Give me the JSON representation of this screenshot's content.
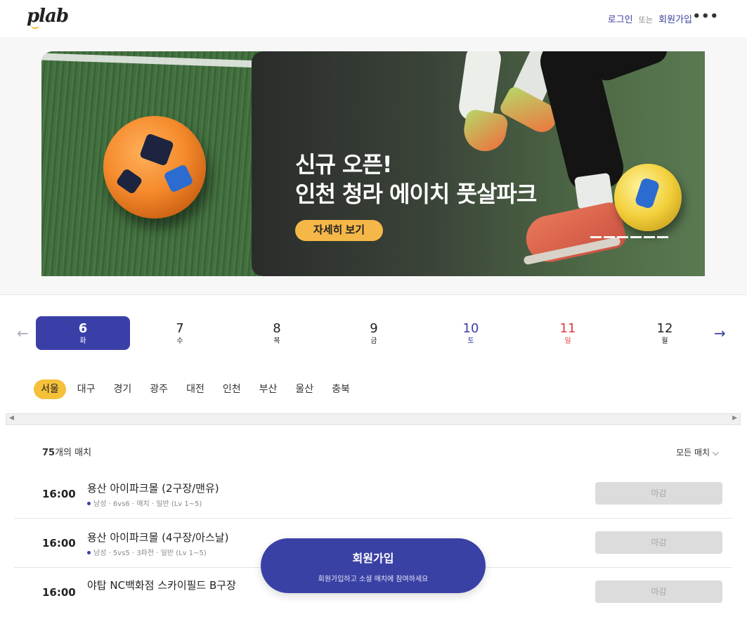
{
  "header": {
    "logo": "plab",
    "login": "로그인",
    "or": "또는",
    "signup": "회원가입",
    "more_icon": "more-dots-icon"
  },
  "banner": {
    "title_line1": "신규 오픈!",
    "title_line2": "인천 청라 에이치 풋살파크",
    "detail_button": "자세히 보기",
    "slide_count": 6
  },
  "dates": {
    "prev_icon": "arrow-left-icon",
    "next_icon": "arrow-right-icon",
    "days": [
      {
        "num": "6",
        "dow": "화"
      },
      {
        "num": "7",
        "dow": "수"
      },
      {
        "num": "8",
        "dow": "목"
      },
      {
        "num": "9",
        "dow": "금"
      },
      {
        "num": "10",
        "dow": "토"
      },
      {
        "num": "11",
        "dow": "일"
      },
      {
        "num": "12",
        "dow": "월"
      }
    ]
  },
  "regions": [
    "서울",
    "대구",
    "경기",
    "광주",
    "대전",
    "인천",
    "부산",
    "울산",
    "충북"
  ],
  "matches": {
    "count_num": "75",
    "count_suffix": "개의 매치",
    "sort_label": "모든 매치",
    "items": [
      {
        "time": "16:00",
        "title": "용산 아이파크몰 (2구장/맨유)",
        "meta": "남성 · 6vs6 · 매치 · 일반 (Lv 1~5)",
        "status": "마감"
      },
      {
        "time": "16:00",
        "title": "용산 아이파크몰 (4구장/아스날)",
        "meta": "남성 · 5vs5 · 3파전 · 일반 (Lv 1~5)",
        "status": "마감"
      },
      {
        "time": "16:00",
        "title": "야탑 NC백화점 스카이필드 B구장",
        "meta": "",
        "status": "마감"
      }
    ]
  },
  "signup_cta": {
    "title": "회원가입",
    "subtitle": "회원가입하고 소셜 매치에 참여하세요"
  },
  "colors": {
    "primary": "#3a3fa8",
    "accent": "#f5c03a",
    "sunday": "#e0393e"
  }
}
